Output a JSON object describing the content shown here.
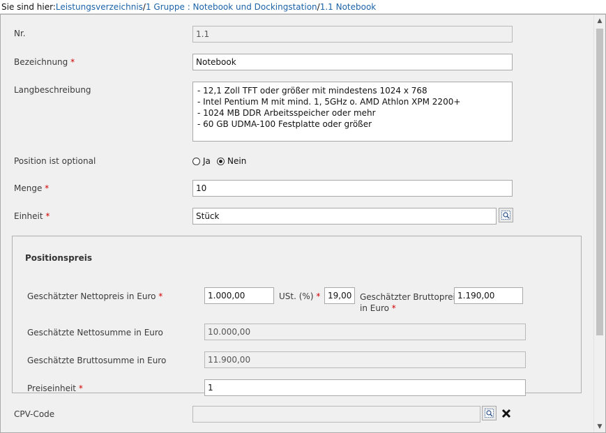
{
  "breadcrumb": {
    "prefix": "Sie sind hier:",
    "items": [
      "Leistungsverzeichnis",
      "1 Gruppe : Notebook und Dockingstation",
      "1.1 Notebook"
    ],
    "separator": "/"
  },
  "form": {
    "nr": {
      "label": "Nr.",
      "value": "1.1"
    },
    "bezeichnung": {
      "label": "Bezeichnung",
      "required": "*",
      "value": "Notebook"
    },
    "langbeschreibung": {
      "label": "Langbeschreibung",
      "lines": [
        "- 12,1 Zoll TFT oder größer mit mindestens 1024 x 768",
        "- Intel Pentium M mit mind. 1, 5GHz o. AMD Athlon XPM 2200+",
        "- 1024 MB DDR Arbeitsspeicher oder mehr",
        "- 60 GB UDMA-100 Festplatte oder größer"
      ]
    },
    "optional": {
      "label": "Position ist optional",
      "options": [
        "Ja",
        "Nein"
      ],
      "selected": "Nein"
    },
    "menge": {
      "label": "Menge",
      "required": "*",
      "value": "10"
    },
    "einheit": {
      "label": "Einheit",
      "required": "*",
      "value": "Stück",
      "button_icon": "lookup-icon"
    },
    "cpv": {
      "label": "CPV-Code",
      "value": "",
      "lookup_icon": "lookup-icon",
      "clear_icon": "close-icon"
    }
  },
  "price": {
    "title": "Positionspreis",
    "netto": {
      "label": "Geschätzter Nettopreis in Euro",
      "required": "*",
      "value": "1.000,00"
    },
    "ust": {
      "label": "USt. (%)",
      "required": "*",
      "value": "19,00"
    },
    "brutto": {
      "label_line1": "Geschätzter Bruttopreis",
      "label_line2": "in Euro",
      "required": "*",
      "value": "1.190,00"
    },
    "nettosumme": {
      "label": "Geschätzte Nettosumme in Euro",
      "value": "10.000,00"
    },
    "bruttosumme": {
      "label": "Geschätzte Bruttosumme in Euro",
      "value": "11.900,00"
    },
    "preiseinheit": {
      "label": "Preiseinheit",
      "required": "*",
      "value": "1"
    }
  },
  "colors": {
    "link": "#1b62a8",
    "required": "#d20000"
  }
}
